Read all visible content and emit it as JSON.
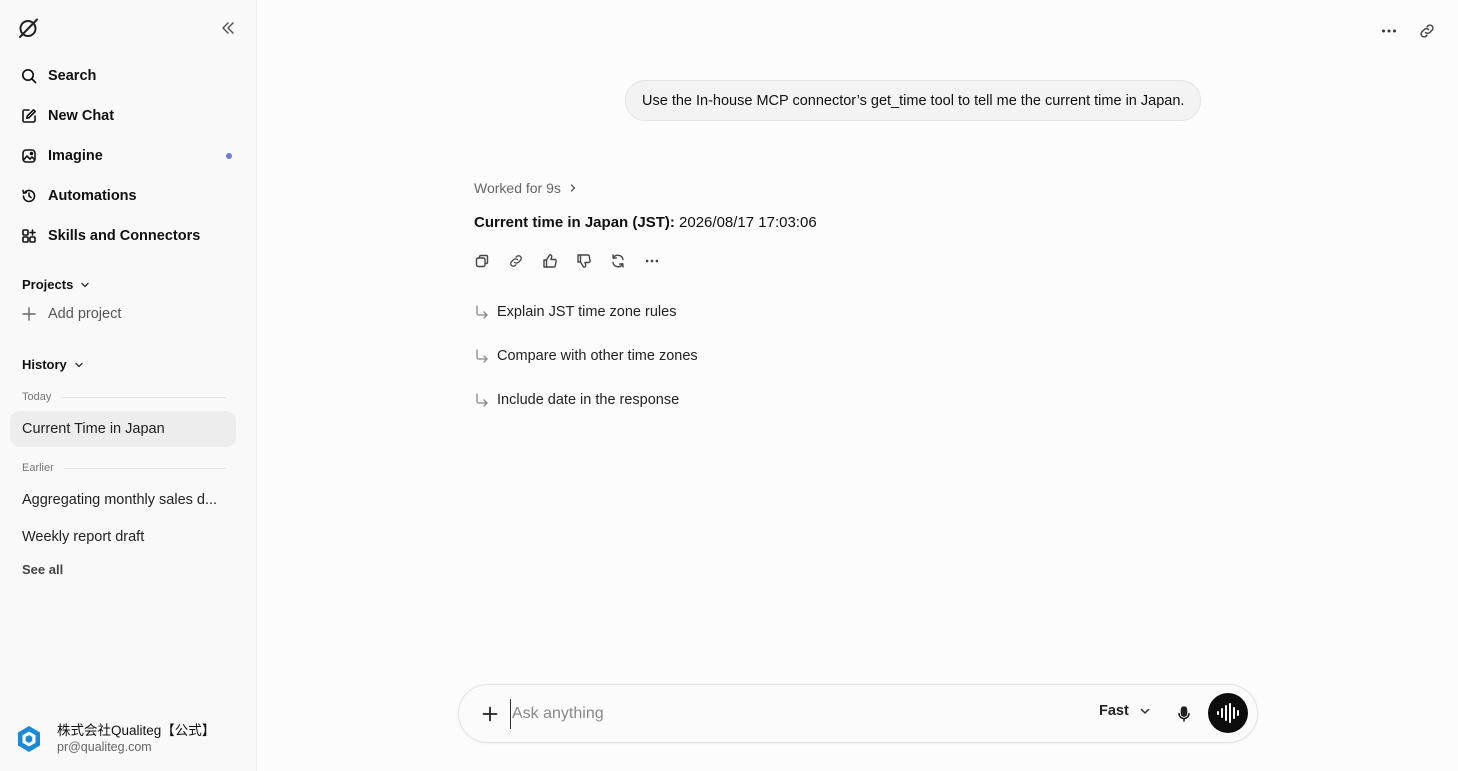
{
  "sidebar": {
    "logo_icon": "grok-logo-icon",
    "nav": [
      {
        "label": "Search",
        "icon": "search-icon"
      },
      {
        "label": "New Chat",
        "icon": "edit-icon"
      },
      {
        "label": "Imagine",
        "icon": "image-icon",
        "has_dot": true
      },
      {
        "label": "Automations",
        "icon": "clock-icon"
      },
      {
        "label": "Skills and Connectors",
        "icon": "grid-plus-icon"
      }
    ],
    "projects_label": "Projects",
    "add_project_label": "Add project",
    "history_label": "History",
    "today_label": "Today",
    "today_items": [
      "Current Time in Japan"
    ],
    "earlier_label": "Earlier",
    "earlier_items": [
      "Aggregating monthly sales d...",
      "Weekly report draft"
    ],
    "see_all_label": "See all",
    "profile": {
      "name": "株式会社Qualiteg【公式】",
      "email": "pr@qualiteg.com"
    }
  },
  "chat": {
    "user_message": "Use the In-house MCP connector’s get_time tool to tell me the current time in Japan.",
    "worked_label": "Worked for 9s",
    "answer_bold": "Current time in Japan (JST):",
    "answer_value": " 2026/08/17 17:03:06",
    "suggestions": [
      "Explain JST time zone rules",
      "Compare with other time zones",
      "Include date in the response"
    ]
  },
  "composer": {
    "placeholder": "Ask anything",
    "mode": "Fast"
  },
  "colors": {
    "accent_dot": "#6f7bd8",
    "voice_button": "#0d0d0d"
  }
}
